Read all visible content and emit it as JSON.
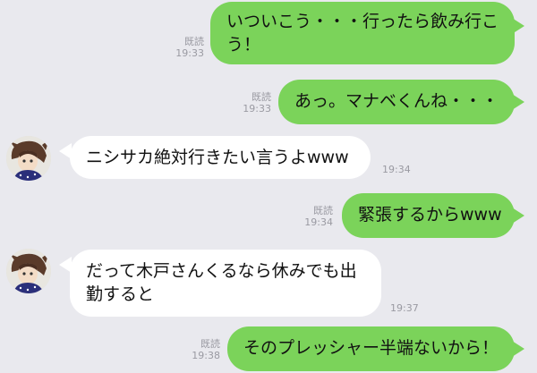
{
  "messages": [
    {
      "side": "out",
      "lines": [
        "いついこう・・・行ったら飲み行こ",
        "う！"
      ],
      "read": "既読",
      "time": "19:33"
    },
    {
      "side": "out",
      "lines": [
        "あっ。マナベくんね・・・"
      ],
      "read": "既読",
      "time": "19:33"
    },
    {
      "side": "in",
      "lines": [
        "ニシサカ絶対行きたい言うよwww"
      ],
      "time": "19:34",
      "avatar": "avatar-icon"
    },
    {
      "side": "out",
      "lines": [
        "緊張するからwww"
      ],
      "read": "既読",
      "time": "19:34"
    },
    {
      "side": "in",
      "lines": [
        "だって木戸さんくるなら休みでも出",
        "勤すると"
      ],
      "time": "19:37",
      "avatar": "avatar-icon"
    },
    {
      "side": "out",
      "lines": [
        "そのプレッシャー半端ないから！"
      ],
      "read": "既読",
      "time": "19:38"
    }
  ],
  "colors": {
    "background": "#e9e9ee",
    "outgoing": "#7bd35a",
    "incoming": "#ffffff",
    "meta": "#9a9aa2"
  }
}
